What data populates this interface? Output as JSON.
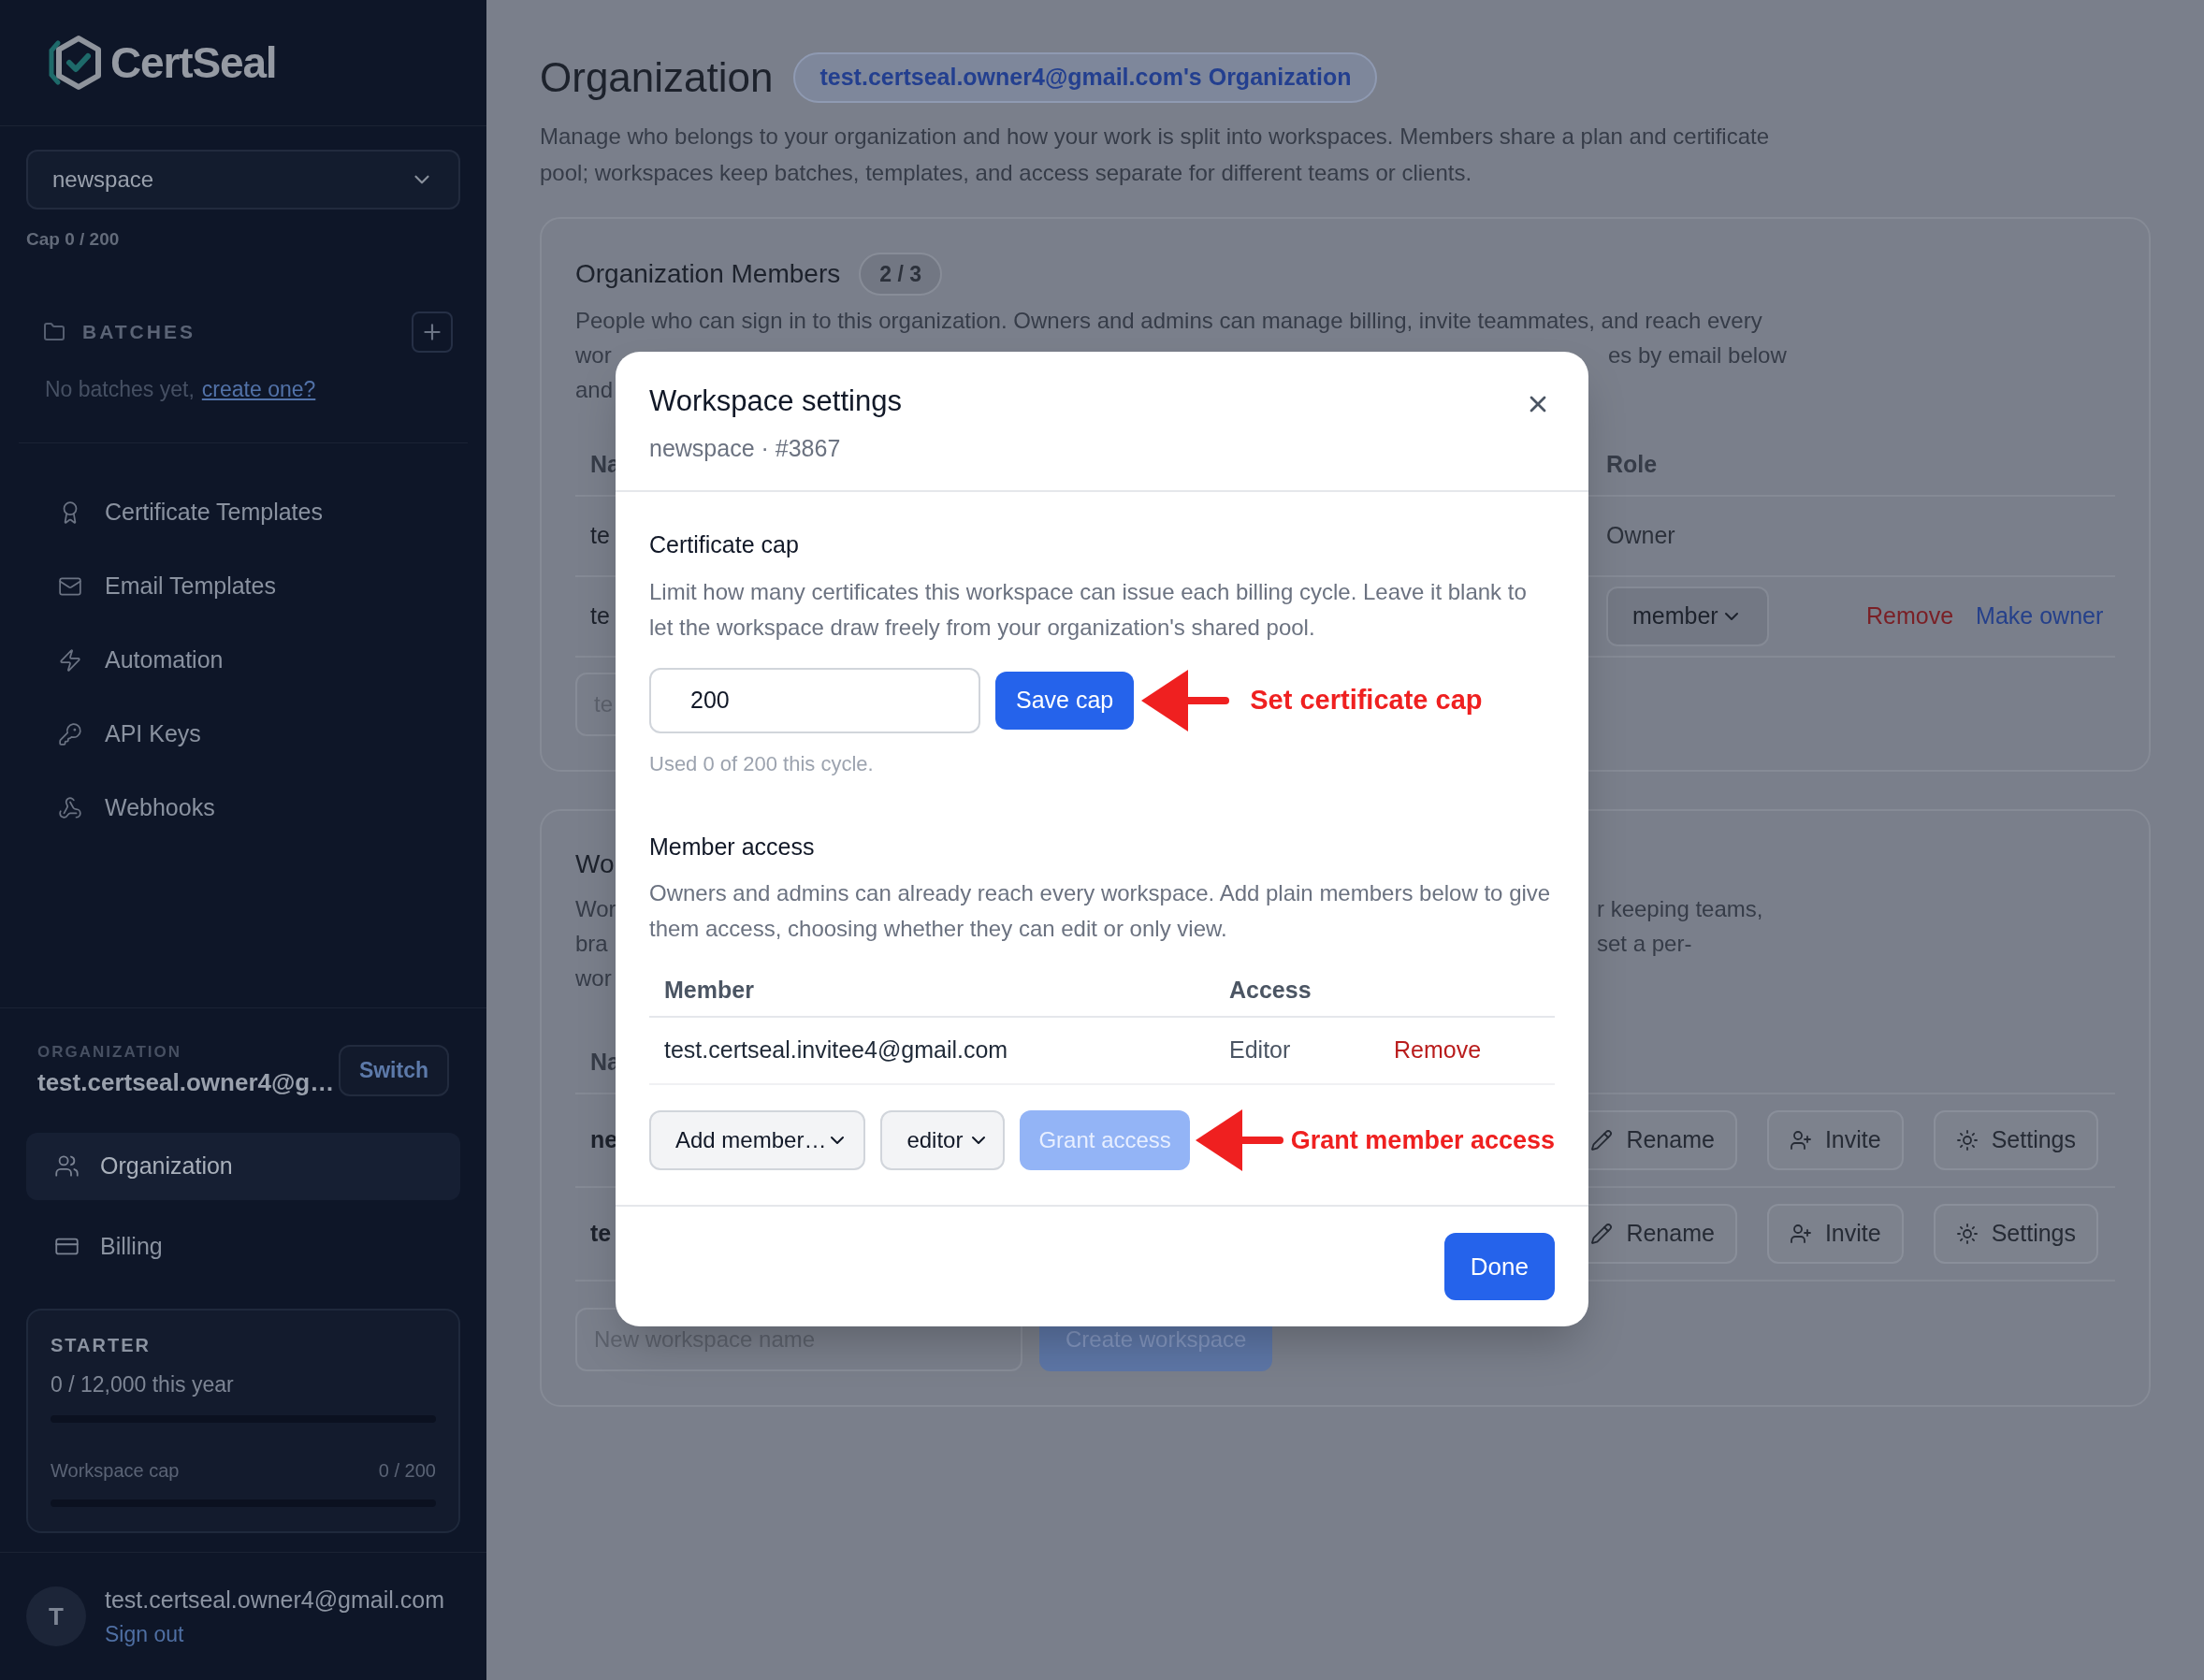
{
  "sidebar": {
    "brand": "CertSeal",
    "workspace_select": "newspace",
    "cap": "Cap 0 / 200",
    "batches": {
      "title": "BATCHES",
      "empty": "No batches yet,",
      "link": "create one?"
    },
    "nav": [
      {
        "label": "Certificate Templates",
        "selected": false
      },
      {
        "label": "Email Templates",
        "selected": false
      },
      {
        "label": "Automation",
        "selected": false
      },
      {
        "label": "API Keys",
        "selected": false
      },
      {
        "label": "Webhooks",
        "selected": false
      }
    ],
    "organization": {
      "label": "ORGANIZATION",
      "name": "test.certseal.owner4@g…",
      "switch": "Switch"
    },
    "org_nav": [
      {
        "label": "Organization",
        "selected": true
      },
      {
        "label": "Billing",
        "selected": false
      }
    ],
    "plan": {
      "name": "STARTER",
      "usage": {
        "text": "0 / 12,000 this year",
        "level": 0
      },
      "cap": {
        "label": "Workspace cap",
        "reading": "0 / 200",
        "level": 0
      }
    },
    "user": {
      "avatar": "T",
      "email": "test.certseal.owner4@gmail.com",
      "sign_out": "Sign out"
    }
  },
  "main": {
    "title": "Organization",
    "org_badge": "test.certseal.owner4@gmail.com's Organization",
    "description": "Manage who belongs to your organization and how your work is split into workspaces. Members share a plan and certificate pool; workspaces keep batches, templates, and access separate for different teams or clients.",
    "members": {
      "title": "Organization Members",
      "count": "2 / 3",
      "description_lines": [
        [
          "People who can sign in to this organization. Owners and admins can manage billing, invite teammates, and reach every"
        ],
        [
          "wor",
          "es by email below"
        ],
        [
          "and"
        ]
      ],
      "columns": [
        "Na",
        "Role"
      ],
      "rows": [
        {
          "kind": "owner",
          "name": "te",
          "role": "Owner"
        },
        {
          "kind": "member",
          "name": "te",
          "role": "member",
          "actions": [
            "Remove",
            "Make owner"
          ]
        }
      ],
      "invite_placeholder": "te"
    },
    "workspaces": {
      "title": "Wo",
      "description_lines": [
        [
          "Wor",
          "r keeping teams,"
        ],
        [
          "bra",
          "set a per-"
        ],
        [
          "wor"
        ]
      ],
      "columns": [
        "Na"
      ],
      "rows": [
        {
          "name": "ne",
          "actions": [
            "Rename",
            "Invite",
            "Settings"
          ]
        },
        {
          "name": "te",
          "actions": [
            "Rename",
            "Invite",
            "Settings"
          ]
        }
      ],
      "create": {
        "placeholder": "New workspace name",
        "button": "Create workspace",
        "disabled": true
      }
    }
  },
  "modal": {
    "title": "Workspace settings",
    "subtitle": "newspace · #3867",
    "cap_section": {
      "title": "Certificate cap",
      "description": "Limit how many certificates this workspace can issue each billing cycle. Leave it blank to let the workspace draw freely from your organization's shared pool.",
      "value": "200",
      "save": "Save cap",
      "usage": "Used 0 of 200 this cycle.",
      "annotation": "Set certificate cap"
    },
    "access_section": {
      "title": "Member access",
      "description": "Owners and admins can already reach every workspace. Add plain members below to give them access, choosing whether they can edit or only view.",
      "columns": [
        "Member",
        "Access"
      ],
      "rows": [
        {
          "member": "test.certseal.invitee4@gmail.com",
          "access": "Editor",
          "action": "Remove"
        }
      ],
      "member_select": "Add member…",
      "access_select": "editor",
      "grant": {
        "label": "Grant access",
        "disabled": true
      },
      "annotation": "Grant member access"
    },
    "done": "Done"
  }
}
